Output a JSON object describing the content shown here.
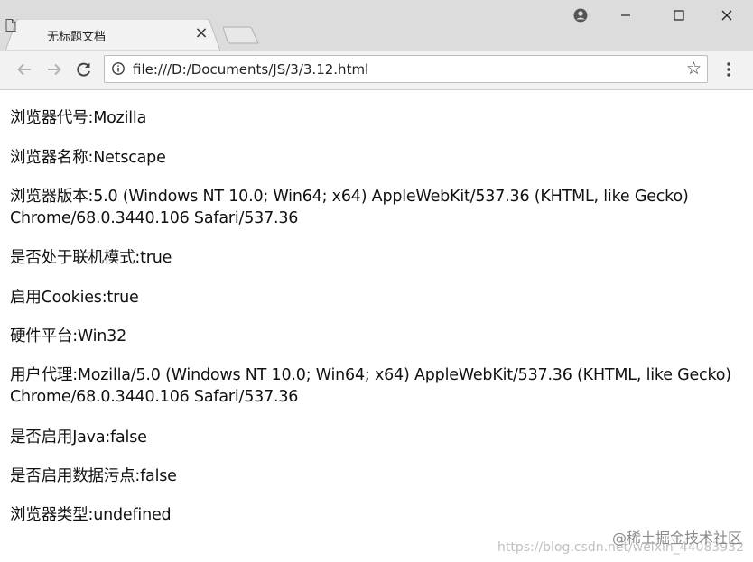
{
  "window": {
    "tab_title": "无标题文档",
    "controls": {
      "minimize": "minimize",
      "maximize": "maximize",
      "close": "close"
    }
  },
  "toolbar": {
    "url": "file:///D:/Documents/JS/3/3.12.html"
  },
  "content": {
    "lines": [
      "浏览器代号:Mozilla",
      "浏览器名称:Netscape",
      "浏览器版本:5.0 (Windows NT 10.0; Win64; x64) AppleWebKit/537.36 (KHTML, like Gecko) Chrome/68.0.3440.106 Safari/537.36",
      "是否处于联机模式:true",
      "启用Cookies:true",
      "硬件平台:Win32",
      "用户代理:Mozilla/5.0 (Windows NT 10.0; Win64; x64) AppleWebKit/537.36 (KHTML, like Gecko) Chrome/68.0.3440.106 Safari/537.36",
      "是否启用Java:false",
      "是否启用数据污点:false",
      "浏览器类型:undefined"
    ]
  },
  "watermark": {
    "brand": "@稀土掘金技术社区",
    "url": "https://blog.csdn.net/weixin_44083932"
  }
}
